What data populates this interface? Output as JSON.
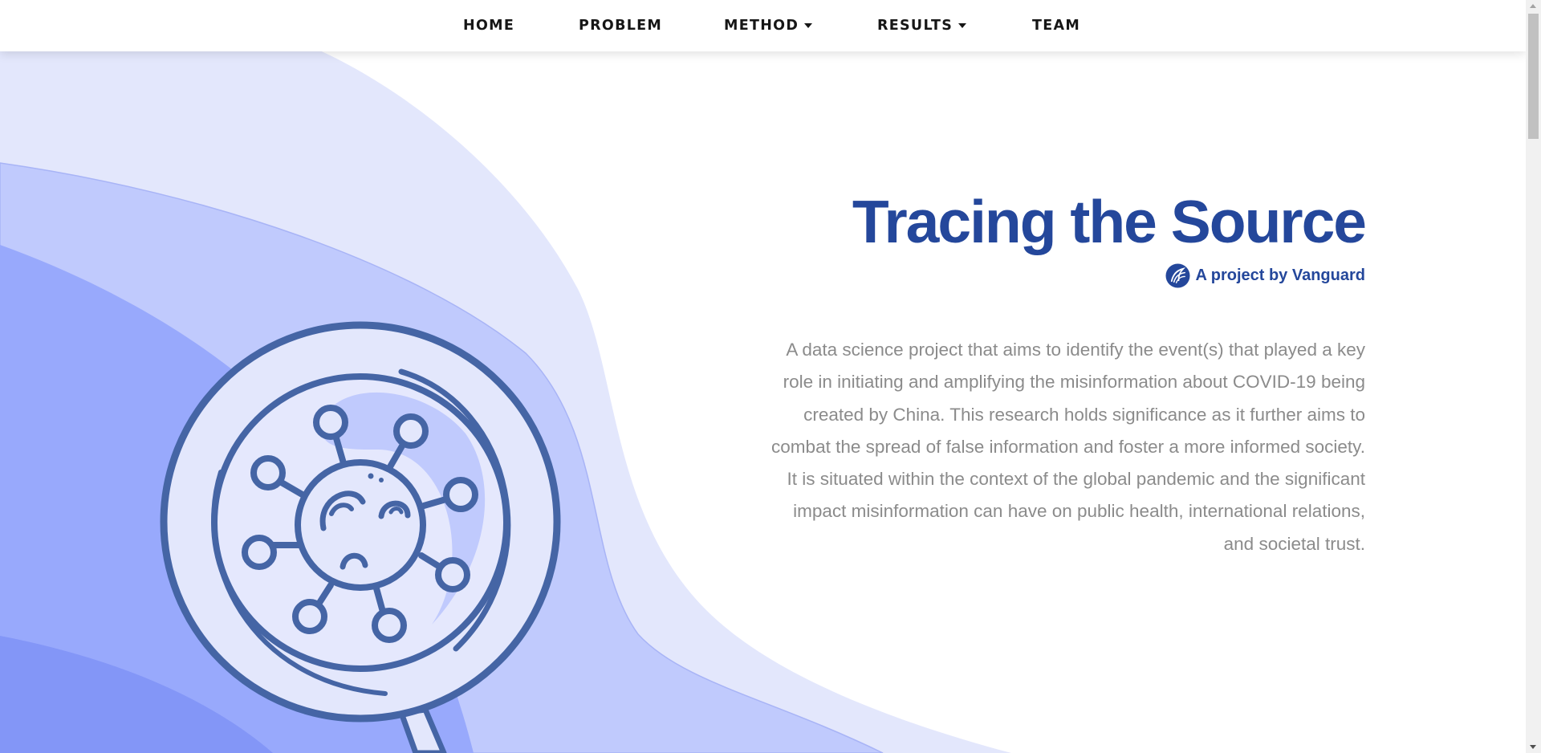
{
  "nav": {
    "items": [
      {
        "label": "HOME",
        "has_dropdown": false
      },
      {
        "label": "PROBLEM",
        "has_dropdown": false
      },
      {
        "label": "METHOD",
        "has_dropdown": true
      },
      {
        "label": "RESULTS",
        "has_dropdown": true
      },
      {
        "label": "TEAM",
        "has_dropdown": false
      }
    ]
  },
  "hero": {
    "title": "Tracing the Source",
    "byline": "A project by Vanguard",
    "byline_icon": "vanguard-logo-icon",
    "illustration_icon": "magnifying-glass-virus-icon",
    "description": "A data science project that aims to identify the event(s) that played a key role in initiating and amplifying the misinformation about COVID-19 being created by China. This research holds significance as it further aims to combat the spread of false information and foster a more informed society. It is situated within the context of the global pandemic and the significant impact misinformation can have on public health, international relations, and societal trust."
  },
  "colors": {
    "title": "#24479b",
    "body_text": "#8b8b8b",
    "nav_text": "#161616",
    "illustration_stroke": "#4565a5",
    "wave_light": "#e3e7fc",
    "wave_mid": "#c0cafd",
    "wave_dark": "#98a9fc",
    "wave_darker": "#8396f7"
  }
}
